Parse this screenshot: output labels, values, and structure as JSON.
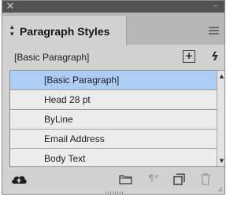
{
  "window": {
    "close_glyph": "✕",
    "collapse_glyph": "‹‹"
  },
  "tab": {
    "label": "Paragraph Styles",
    "arrows_icon": "updown-arrows-icon"
  },
  "current_style": "[Basic Paragraph]",
  "styles": [
    {
      "label": "[Basic Paragraph]",
      "selected": true
    },
    {
      "label": "Head 28 pt",
      "selected": false
    },
    {
      "label": "ByLine",
      "selected": false
    },
    {
      "label": "Email Address",
      "selected": false
    },
    {
      "label": "Body Text",
      "selected": false
    }
  ],
  "toolbar": {
    "icons": [
      "cloud-library-icon",
      "folder-icon",
      "clear-overrides-icon",
      "new-style-icon",
      "trash-icon"
    ],
    "clear_overrides_glyph": "¶*"
  },
  "colors": {
    "panel_bg": "#d2d2d2",
    "title_bar": "#525252",
    "selected_row": "#aecdf5",
    "list_bg": "#ececec"
  }
}
